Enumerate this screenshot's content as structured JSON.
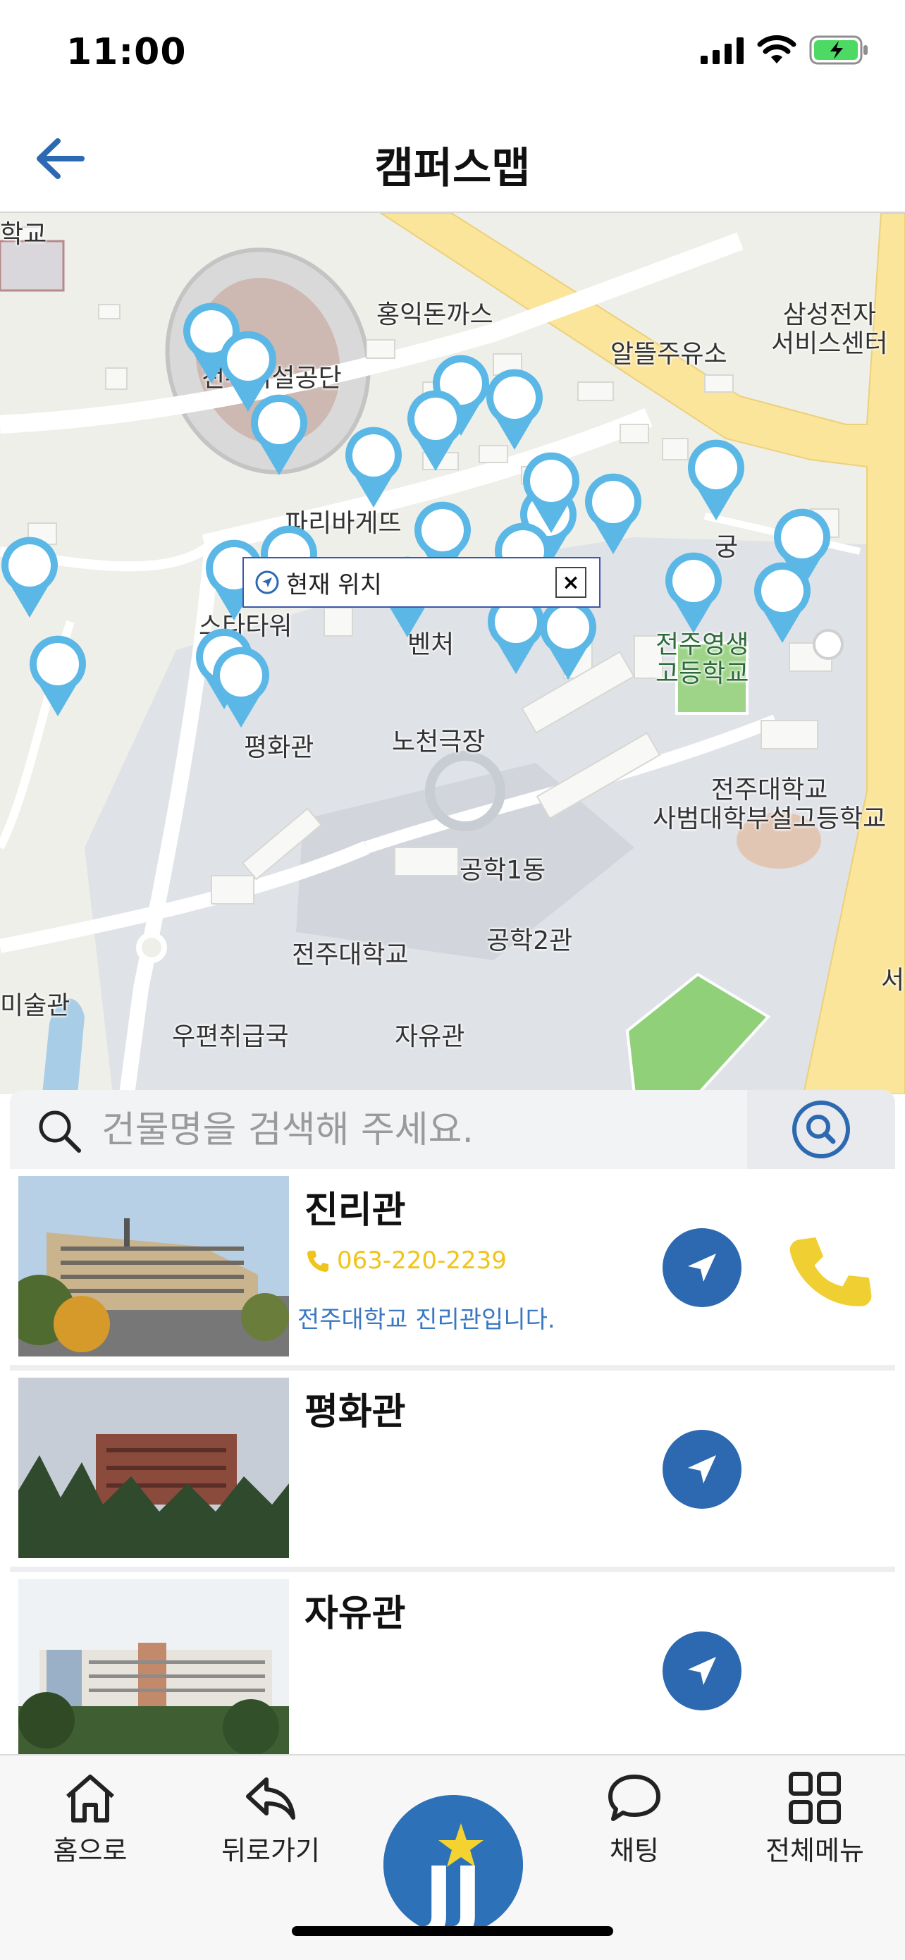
{
  "status_bar": {
    "time": "11:00"
  },
  "header": {
    "title": "캠퍼스맵"
  },
  "map": {
    "current_location_label": "현재 위치",
    "close_glyph": "×",
    "labels": [
      "학교",
      "홍익돈까스",
      "알뜰주유소",
      "삼성전자\n서비스센터",
      "전주시설공단",
      "파리바게뜨",
      "궁",
      "스타타워",
      "벤처",
      "전주영생\n고등학교",
      "평화관",
      "노천극장",
      "전주대학교\n사범대학부설고등학교",
      "공학1동",
      "공학2관",
      "전주대학교",
      "미술관",
      "우편취급국",
      "자유관",
      "서"
    ]
  },
  "search": {
    "placeholder": "건물명을 검색해 주세요."
  },
  "buildings": [
    {
      "name": "진리관",
      "phone": "063-220-2239",
      "description": "전주대학교 진리관입니다."
    },
    {
      "name": "평화관",
      "phone": "",
      "description": ""
    },
    {
      "name": "자유관",
      "phone": "",
      "description": ""
    }
  ],
  "tabbar": {
    "home": "홈으로",
    "back": "뒤로가기",
    "chat": "채팅",
    "menu": "전체메뉴",
    "logo_text": "JJ"
  },
  "colors": {
    "brand_blue": "#2d69b1",
    "pin_blue": "#5bb8e6",
    "phone_yellow": "#f0c419",
    "desc_blue": "#3a78c2",
    "road_yellow": "#fbe59a"
  },
  "icons": [
    "back-arrow-icon",
    "search-icon",
    "location-arrow-icon",
    "phone-icon",
    "home-icon",
    "reply-icon",
    "chat-icon",
    "grid-icon",
    "signal-icon",
    "wifi-icon",
    "battery-icon",
    "map-pin-icon"
  ]
}
